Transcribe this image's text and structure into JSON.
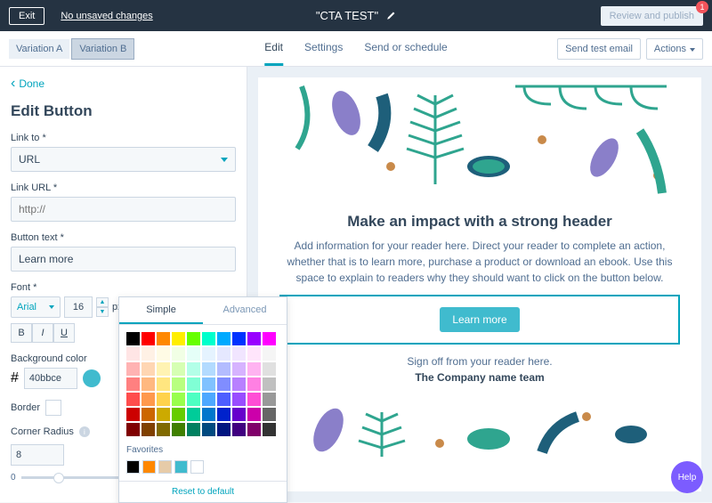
{
  "topbar": {
    "exit": "Exit",
    "unsaved": "No unsaved changes",
    "title": "\"CTA TEST\"",
    "review": "Review and publish",
    "badge": "1"
  },
  "secondbar": {
    "var_a": "Variation A",
    "var_b": "Variation B",
    "tabs": {
      "edit": "Edit",
      "settings": "Settings",
      "send": "Send or schedule"
    },
    "send_test": "Send test email",
    "actions": "Actions"
  },
  "sidebar": {
    "done": "Done",
    "title": "Edit Button",
    "link_to_label": "Link to *",
    "link_to_value": "URL",
    "link_url_label": "Link URL *",
    "link_url_placeholder": "http://",
    "button_text_label": "Button text *",
    "button_text_value": "Learn more",
    "font_label": "Font *",
    "font_family": "Arial",
    "font_size": "16",
    "px": "px",
    "bold": "B",
    "italic": "I",
    "underline": "U",
    "bg_label": "Background color",
    "hash": "#",
    "bg_hex": "40bbce",
    "border_label": "Border",
    "corner_label": "Corner Radius",
    "corner_value": "8",
    "slider_min": "0"
  },
  "popover": {
    "tab_simple": "Simple",
    "tab_advanced": "Advanced",
    "colors_row1": [
      "#000000",
      "#ff0000",
      "#ff8800",
      "#ffee00",
      "#66ff00",
      "#00ffcc",
      "#00aaff",
      "#0033ff",
      "#9900ff",
      "#ff00ff"
    ],
    "colors_grid": [
      "#ffe5e5",
      "#fff1e5",
      "#fffbe5",
      "#f1ffe5",
      "#e5fff8",
      "#e5f3ff",
      "#e5e8ff",
      "#f1e5ff",
      "#ffe5fb",
      "#f5f5f5",
      "#ffb3b3",
      "#ffd6b3",
      "#fff3b3",
      "#d6ffb3",
      "#b3ffe8",
      "#b3dbff",
      "#b3bcff",
      "#d6b3ff",
      "#ffb3f1",
      "#e0e0e0",
      "#ff8080",
      "#ffb880",
      "#ffe680",
      "#b8ff80",
      "#80ffd5",
      "#80c2ff",
      "#808dff",
      "#b880ff",
      "#ff80e3",
      "#c0c0c0",
      "#ff4d4d",
      "#ff994d",
      "#ffd24d",
      "#99ff4d",
      "#4dffc2",
      "#4da8ff",
      "#4d5eff",
      "#994dff",
      "#ff4dd5",
      "#999999",
      "#cc0000",
      "#cc6600",
      "#ccaa00",
      "#66cc00",
      "#00cc99",
      "#0077cc",
      "#0022cc",
      "#6600cc",
      "#cc00aa",
      "#666666",
      "#800000",
      "#804000",
      "#806a00",
      "#408000",
      "#008060",
      "#004a80",
      "#001580",
      "#400080",
      "#80006a",
      "#333333"
    ],
    "favorites_label": "Favorites",
    "favorites": [
      "#000000",
      "#ff8800",
      "#e6cba8",
      "#40bbce",
      "#ffffff"
    ],
    "reset": "Reset to default"
  },
  "preview": {
    "headline": "Make an impact with a strong header",
    "body": "Add information for your reader here. Direct your reader to complete an action, whether that is to learn more, purchase a product or download an ebook. Use this space to explain to readers why they should want to click on the button below.",
    "cta": "Learn more",
    "signoff": "Sign off from your reader here.",
    "team": "The Company name team"
  },
  "help": "Help"
}
